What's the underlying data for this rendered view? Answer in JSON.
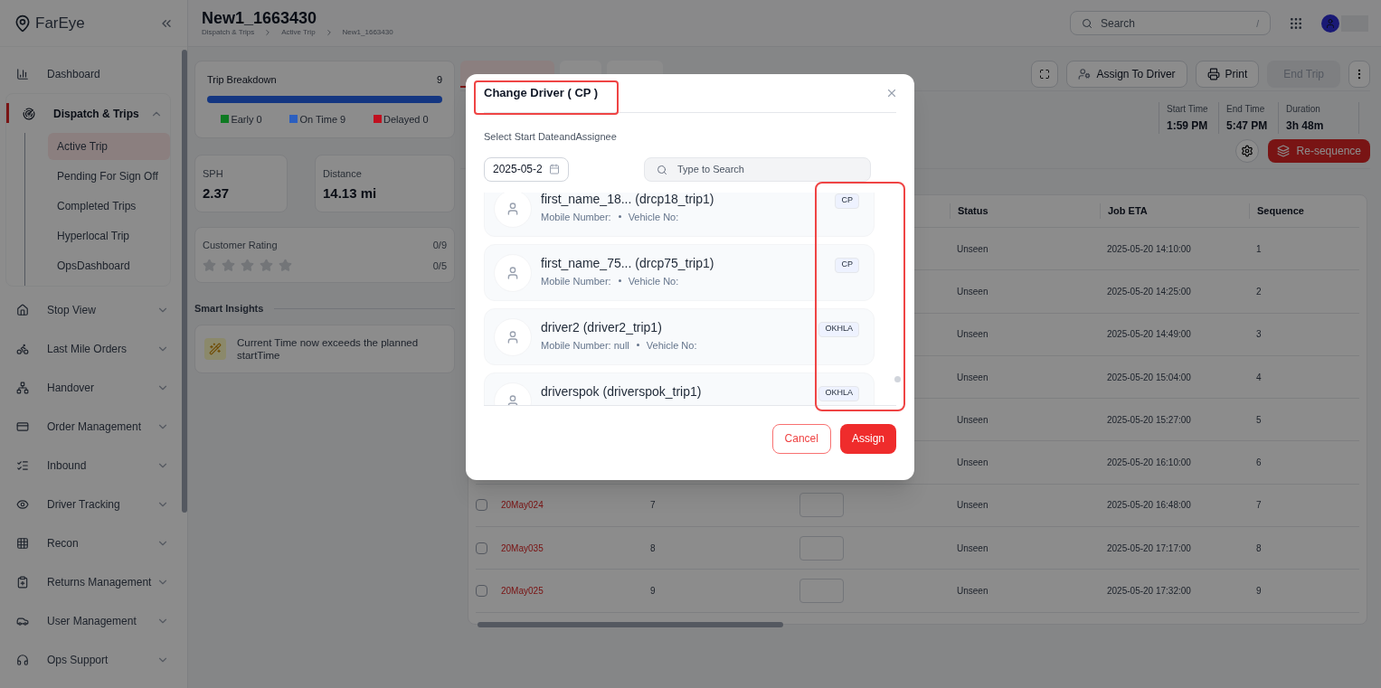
{
  "brand": {
    "name": "FarEye"
  },
  "sidebar": {
    "items": [
      {
        "label": "Dashboard",
        "kind": "link",
        "selected": false
      },
      {
        "label": "Dispatch & Trips",
        "kind": "group",
        "selected": true,
        "expanded": true,
        "children": [
          {
            "label": "Active Trip",
            "selected": true
          },
          {
            "label": "Pending For Sign Off",
            "selected": false
          },
          {
            "label": "Completed Trips",
            "selected": false
          },
          {
            "label": "Hyperlocal Trip",
            "selected": false
          },
          {
            "label": "OpsDashboard",
            "selected": false
          }
        ]
      },
      {
        "label": "Stop View",
        "kind": "group",
        "selected": false,
        "expanded": false
      },
      {
        "label": "Last Mile Orders",
        "kind": "group",
        "selected": false,
        "expanded": false
      },
      {
        "label": "Handover",
        "kind": "group",
        "selected": false,
        "expanded": false
      },
      {
        "label": "Order Management",
        "kind": "group",
        "selected": false,
        "expanded": false
      },
      {
        "label": "Inbound",
        "kind": "group",
        "selected": false,
        "expanded": false
      },
      {
        "label": "Driver Tracking",
        "kind": "group",
        "selected": false,
        "expanded": false
      },
      {
        "label": "Recon",
        "kind": "group",
        "selected": false,
        "expanded": false
      },
      {
        "label": "Returns Management",
        "kind": "group",
        "selected": false,
        "expanded": false
      },
      {
        "label": "User Management",
        "kind": "group",
        "selected": false,
        "expanded": false
      },
      {
        "label": "Ops Support",
        "kind": "group",
        "selected": false,
        "expanded": false
      }
    ]
  },
  "header": {
    "title": "New1_1663430",
    "breadcrumbs": [
      "Dispatch & Trips",
      "Active Trip",
      "New1_1663430"
    ],
    "search": {
      "placeholder": "Search",
      "shortcut": "/"
    }
  },
  "trip_breakdown": {
    "title": "Trip Breakdown",
    "count": "9",
    "level": 1,
    "legend": [
      {
        "label": "Early 0",
        "color": "#0e7a22"
      },
      {
        "label": "On Time 9",
        "color": "#2c5fbf"
      },
      {
        "label": "Delayed 0",
        "color": "#c0101f"
      }
    ]
  },
  "stats": [
    {
      "label": "SPH",
      "value": "2.37"
    },
    {
      "label": "Distance",
      "value": "14.13 mi"
    }
  ],
  "customer_rating": {
    "label": "Customer Rating",
    "count": "0/9",
    "score": "0/5",
    "stars": 0
  },
  "smart_insights": {
    "title": "Smart Insights",
    "items": [
      "Current Time now exceeds the planned startTime"
    ]
  },
  "tabs": [
    {
      "selected": true
    },
    {
      "selected": false
    },
    {
      "selected": false
    }
  ],
  "actions": {
    "assign": "Assign To Driver",
    "print": "Print",
    "end_trip": {
      "label": "End Trip",
      "disabled": true
    }
  },
  "times": [
    {
      "label": "Start Time",
      "value": "1:59 PM"
    },
    {
      "label": "End Time",
      "value": "5:47 PM"
    },
    {
      "label": "Duration",
      "value": "3h 48m"
    }
  ],
  "resequence": "Re-sequence",
  "table": {
    "columns": [
      "Status",
      "Job ETA",
      "Sequence"
    ],
    "rows": [
      {
        "status": "Unseen",
        "eta": "2025-05-20 14:10:00",
        "sequence": "1"
      },
      {
        "status": "Unseen",
        "eta": "2025-05-20 14:25:00",
        "sequence": "2"
      },
      {
        "status": "Unseen",
        "eta": "2025-05-20 14:49:00",
        "sequence": "3"
      },
      {
        "status": "Unseen",
        "eta": "2025-05-20 15:04:00",
        "sequence": "4"
      },
      {
        "status": "Unseen",
        "eta": "2025-05-20 15:27:00",
        "sequence": "5"
      },
      {
        "status": "Unseen",
        "eta": "2025-05-20 16:10:00",
        "sequence": "6"
      },
      {
        "checked": false,
        "order": "20May024",
        "number": "7",
        "status": "Unseen",
        "eta": "2025-05-20 16:48:00",
        "sequence": "7"
      },
      {
        "checked": false,
        "order": "20May035",
        "number": "8",
        "status": "Unseen",
        "eta": "2025-05-20 17:17:00",
        "sequence": "8"
      },
      {
        "checked": false,
        "order": "20May025",
        "number": "9",
        "status": "Unseen",
        "eta": "2025-05-20 17:32:00",
        "sequence": "9"
      }
    ]
  },
  "modal": {
    "title": "Change Driver ( CP )",
    "title_highlighted": true,
    "subtitle": "Select Start DateandAssignee",
    "date": "2025-05-2",
    "search_placeholder": "Type to Search",
    "tags_highlighted": true,
    "drivers": [
      {
        "name": "first_name_18... (drcp18_trip1)",
        "mobile": "Mobile Number:",
        "vehicle": "Vehicle No:",
        "tag": "CP"
      },
      {
        "name": "first_name_75... (drcp75_trip1)",
        "mobile": "Mobile Number:",
        "vehicle": "Vehicle No:",
        "tag": "CP"
      },
      {
        "name": "driver2 (driver2_trip1)",
        "mobile": "Mobile Number: null",
        "vehicle": "Vehicle No:",
        "tag": "OKHLA"
      },
      {
        "name": "driverspok (driverspok_trip1)",
        "tag": "OKHLA"
      }
    ],
    "buttons": {
      "cancel": "Cancel",
      "assign": "Assign"
    }
  }
}
